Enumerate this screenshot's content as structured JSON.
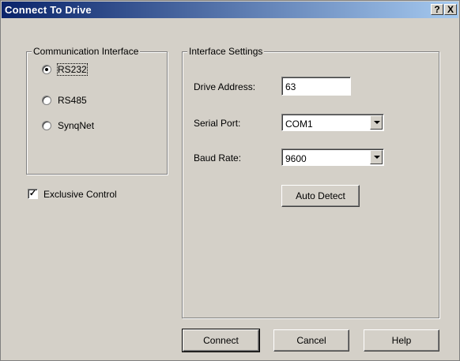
{
  "window": {
    "title": "Connect To Drive",
    "help_button": "?",
    "close_button": "X"
  },
  "communication_interface": {
    "legend": "Communication Interface",
    "options": [
      {
        "label": "RS232",
        "selected": true
      },
      {
        "label": "RS485",
        "selected": false
      },
      {
        "label": "SynqNet",
        "selected": false
      }
    ]
  },
  "exclusive_control": {
    "label": "Exclusive Control",
    "checked": true
  },
  "interface_settings": {
    "legend": "Interface Settings",
    "drive_address": {
      "label": "Drive Address:",
      "value": "63"
    },
    "serial_port": {
      "label": "Serial Port:",
      "value": "COM1"
    },
    "baud_rate": {
      "label": "Baud Rate:",
      "value": "9600"
    },
    "auto_detect_label": "Auto Detect"
  },
  "buttons": {
    "connect": "Connect",
    "cancel": "Cancel",
    "help": "Help"
  },
  "icons": {
    "help": "question-mark-icon",
    "close": "close-x-icon",
    "dropdown": "chevron-down-icon",
    "check": "checkmark-icon",
    "radio_dot": "radio-dot-icon"
  }
}
